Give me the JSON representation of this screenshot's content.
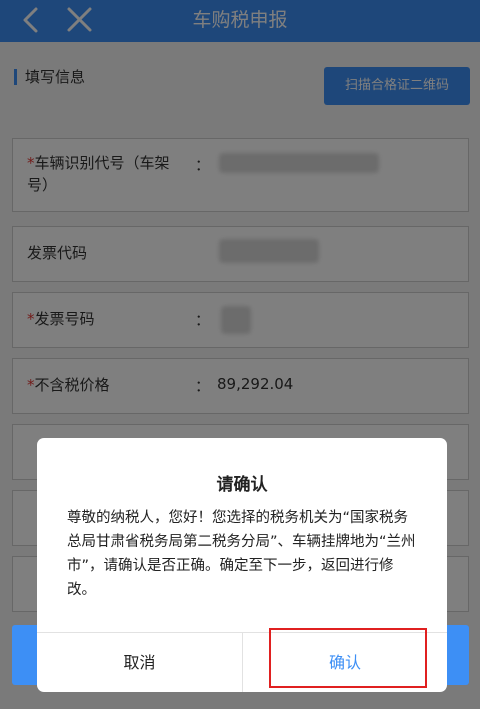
{
  "header": {
    "title": "车购税申报",
    "back_icon": "back-arrow-icon",
    "close_icon": "close-icon",
    "background": "#3d8ff5"
  },
  "section": {
    "title": "填写信息",
    "scan_button": "扫描合格证二维码"
  },
  "form": {
    "required_mark": "*",
    "colon": "：",
    "rows": [
      {
        "label": "车辆识别代号（车架号）",
        "required": true,
        "value": ""
      },
      {
        "label": "发票代码",
        "required": false,
        "value": ""
      },
      {
        "label": "发票号码",
        "required": true,
        "value": ""
      },
      {
        "label": "不含税价格",
        "required": true,
        "value": "89,292.04"
      }
    ]
  },
  "dialog": {
    "title": "请确认",
    "message": "尊敬的纳税人，您好！您选择的税务机关为“国家税务总局甘肃省税务局第二税务分局”、车辆挂牌地为“兰州市”，请确认是否正确。确定至下一步，返回进行修改。",
    "cancel_label": "取消",
    "confirm_label": "确认",
    "confirm_color": "#3d8ff5",
    "highlight_color": "#e02020"
  }
}
